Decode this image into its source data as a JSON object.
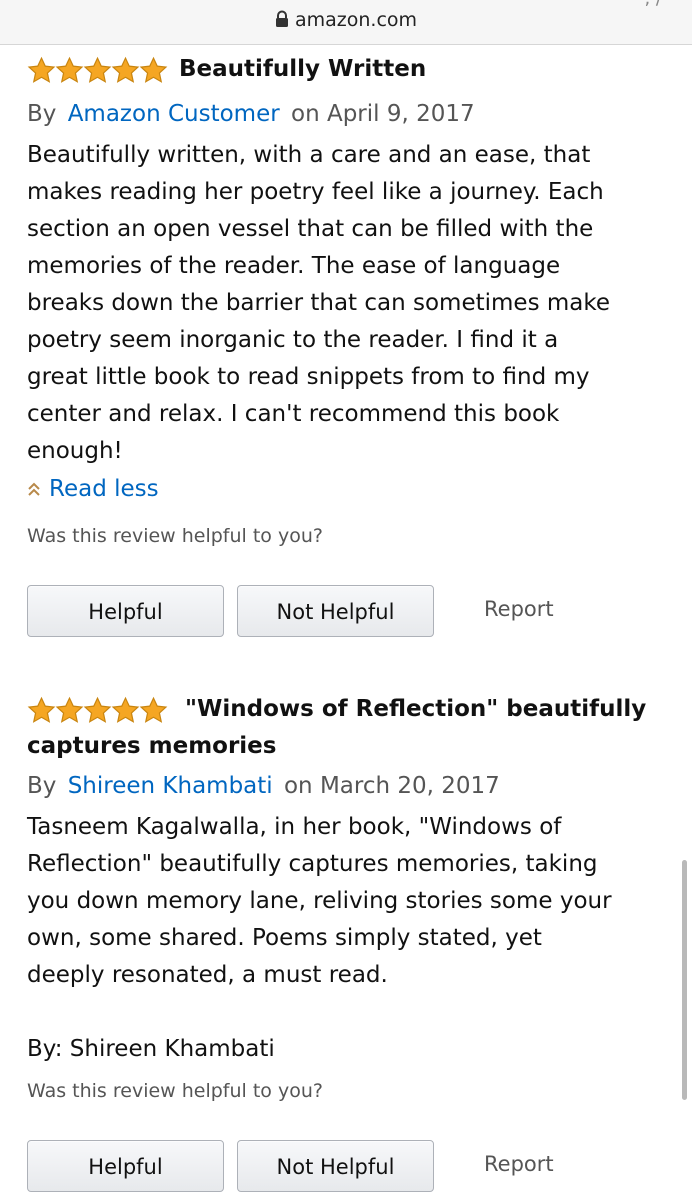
{
  "browser": {
    "domain": "amazon.com",
    "status_fragment": "', /"
  },
  "colors": {
    "link": "#0066c0",
    "star": "#f5a623",
    "muted": "#555555"
  },
  "reviews": [
    {
      "stars": 5,
      "title": "Beautifully Written",
      "by_prefix": "By",
      "author": "Amazon Customer",
      "date": "on April 9, 2017",
      "body": "Beautifully written, with a care and an ease, that\nmakes reading her poetry feel like a journey. Each\nsection an open vessel that can be filled with the\nmemories of the reader. The ease of language\nbreaks down the barrier that can sometimes make\npoetry seem inorganic to the reader. I find it a\ngreat little book to read snippets from to find my\ncenter and relax. I can't recommend this book\nenough!",
      "read_less": "Read less",
      "helpful_question": "Was this review helpful to you?",
      "helpful_label": "Helpful",
      "not_helpful_label": "Not Helpful",
      "report_label": "Report"
    },
    {
      "stars": 5,
      "title": "\"Windows of Reflection\" beautifully\ncaptures memories",
      "by_prefix": "By",
      "author": "Shireen Khambati",
      "date": "on March 20, 2017",
      "body": "Tasneem Kagalwalla, in her book, \"Windows of\nReflection\" beautifully captures memories, taking\nyou down memory lane, reliving stories some your\nown, some shared. Poems simply stated, yet\ndeeply resonated, a must read.\n\nBy: Shireen Khambati",
      "helpful_question": "Was this review helpful to you?",
      "helpful_label": "Helpful",
      "not_helpful_label": "Not Helpful",
      "report_label": "Report"
    }
  ]
}
